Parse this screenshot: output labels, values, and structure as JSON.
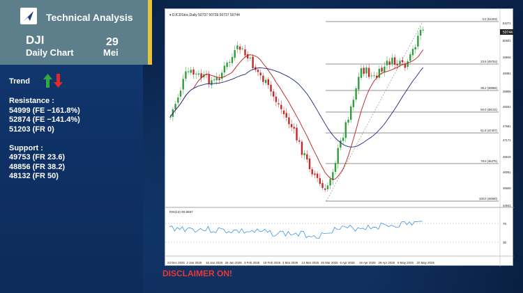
{
  "header": {
    "app_title": "Technical Analysis",
    "ticker": "DJI",
    "chart_kind": "Daily Chart",
    "day": "29",
    "month": "Mei"
  },
  "trend": {
    "label": "Trend",
    "icons": [
      "up-arrow-green",
      "down-arrow-red"
    ]
  },
  "resistance": {
    "title": "Resistance :",
    "levels": [
      "54999 (FE −161.8%)",
      "52874 (FE −141.4%)",
      "51203 (FR 0)"
    ]
  },
  "support": {
    "title": "Support :",
    "levels": [
      "49753 (FR 23.6)",
      "48856 (FR 38.2)",
      "48132 (FR 50)"
    ]
  },
  "chart": {
    "header_text": "▾ DJCDStoc,Daily  50737 50739 50737 50744",
    "rsi_label": "RSI(14) 60.8657",
    "fib_labels": [
      "0.0 (51203)",
      "23.6 (49753)",
      "38.2 (48856)",
      "50.0 (48132)",
      "61.8 (47407)",
      "78.6 (46375)",
      "100.0 (45060)"
    ],
    "price_ticks": [
      "51071",
      "50501",
      "49946",
      "49381",
      "48806",
      "48251",
      "47681",
      "47171",
      "46616",
      "46061",
      "45506",
      "44941"
    ],
    "current_price_tag": "50744",
    "rsi_ticks": [
      "70",
      "30"
    ],
    "date_ticks": [
      "23 Dec 2025",
      "2 Jan 2026",
      "16 Jan 2026",
      "26 Jan 2026",
      "3 Feb 2026",
      "19 Feb 2026",
      "3 Mar 2026",
      "13 Mar 2026",
      "25 Mar 2026",
      "6 Apr 2026",
      "16 Apr 2026",
      "28 Apr 2026",
      "8 May 2026",
      "20 May 2026"
    ],
    "colors": {
      "up": "#2e9e3a",
      "down": "#c62828",
      "ma_fast": "#b71c1c",
      "ma_slow": "#1a237e",
      "rsi": "#1e88e5"
    }
  },
  "disclaimer": "DISCLAIMER ON!"
}
